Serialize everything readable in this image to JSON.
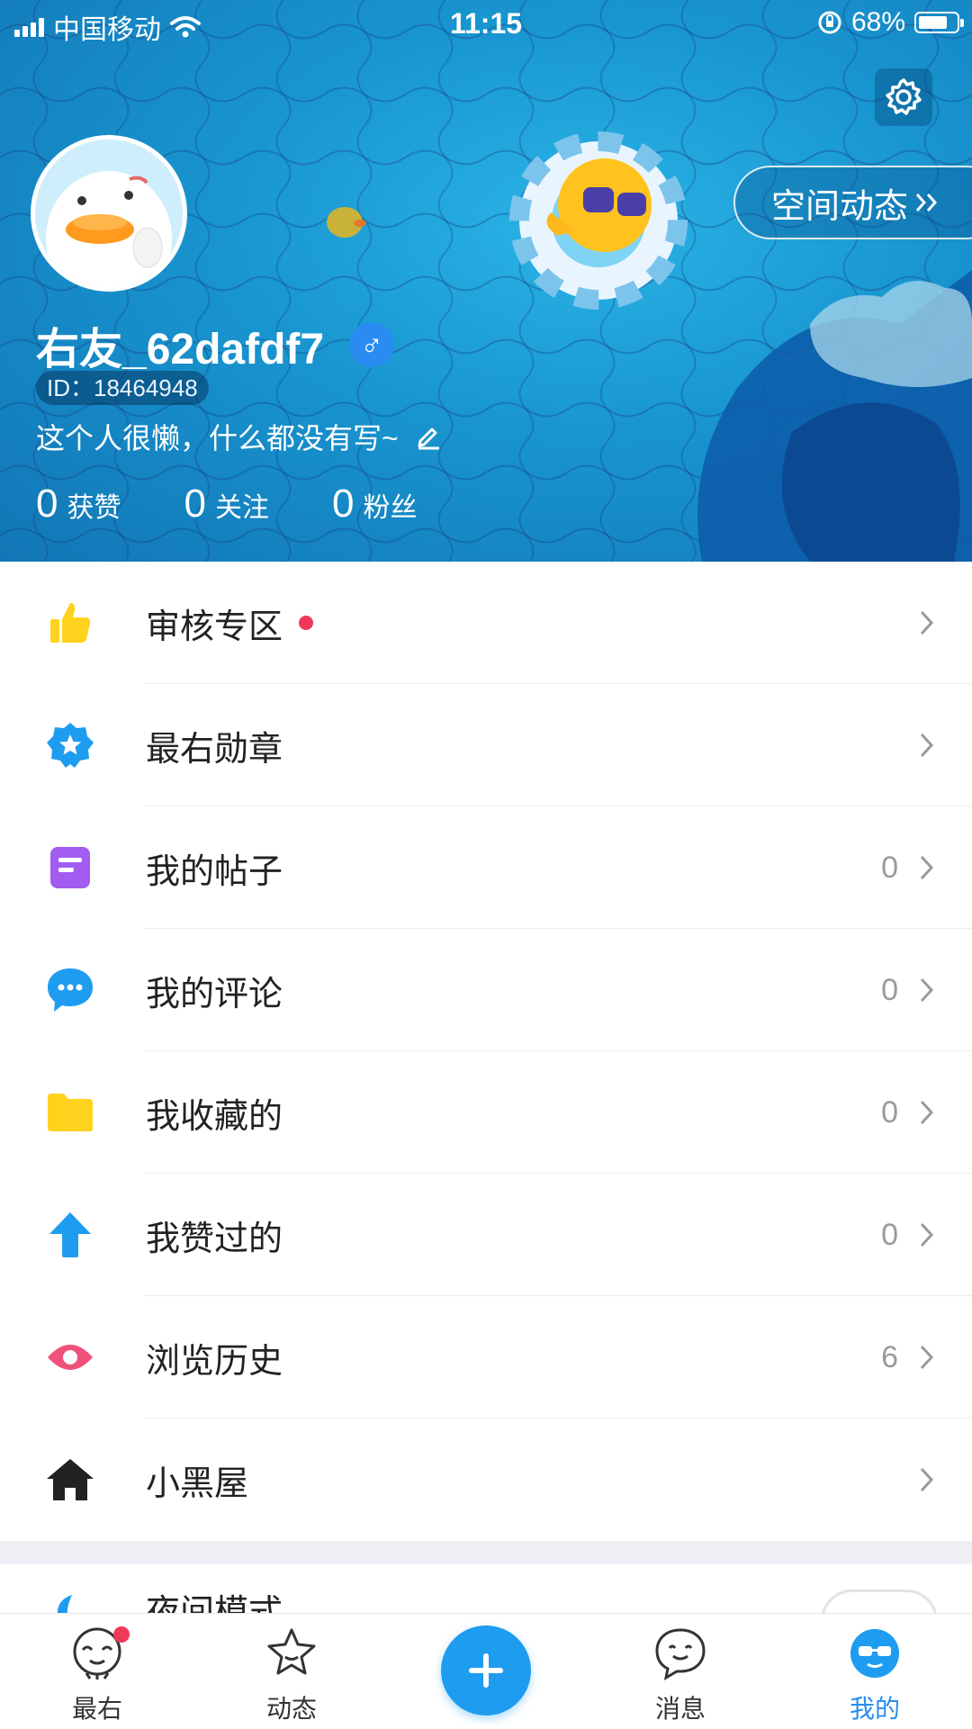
{
  "status_bar": {
    "carrier": "中国移动",
    "time": "11:15",
    "battery_percent": "68%",
    "battery_level": 0.68
  },
  "profile": {
    "username": "右友_62dafdf7",
    "gender_symbol": "♂",
    "user_id": "ID：18464948",
    "bio": "这个人很懒，什么都没有写~",
    "space_button_label": "空间动态",
    "stats": [
      {
        "value": "0",
        "label": "获赞"
      },
      {
        "value": "0",
        "label": "关注"
      },
      {
        "value": "0",
        "label": "粉丝"
      }
    ]
  },
  "menu": {
    "items": [
      {
        "label": "审核专区",
        "icon": "thumbs-up-icon",
        "color": "#ffd21e",
        "count": "",
        "has_dot": true
      },
      {
        "label": "最右勋章",
        "icon": "medal-icon",
        "color": "#1e9cf0",
        "count": ""
      },
      {
        "label": "我的帖子",
        "icon": "post-icon",
        "color": "#a25cf0",
        "count": "0"
      },
      {
        "label": "我的评论",
        "icon": "comment-icon",
        "color": "#1e9cf0",
        "count": "0"
      },
      {
        "label": "我收藏的",
        "icon": "folder-icon",
        "color": "#ffd21e",
        "count": "0"
      },
      {
        "label": "我赞过的",
        "icon": "up-arrow-icon",
        "color": "#1e9cf0",
        "count": "0"
      },
      {
        "label": "浏览历史",
        "icon": "eye-icon",
        "color": "#f0507a",
        "count": "6"
      },
      {
        "label": "小黑屋",
        "icon": "house-icon",
        "color": "#222222",
        "count": ""
      }
    ],
    "partial_item_label": "夜间模式"
  },
  "tabbar": {
    "tabs": [
      {
        "label": "最右",
        "icon": "zuiyou-face-icon",
        "has_badge": true
      },
      {
        "label": "动态",
        "icon": "star-icon"
      },
      {
        "label": "消息",
        "icon": "message-bubble-icon"
      },
      {
        "label": "我的",
        "icon": "me-face-icon",
        "active": true
      }
    ],
    "fab_icon": "plus-icon"
  },
  "colors": {
    "accent": "#1e9cf0",
    "header_bg": "#1894cf",
    "badge": "#f0385a"
  }
}
